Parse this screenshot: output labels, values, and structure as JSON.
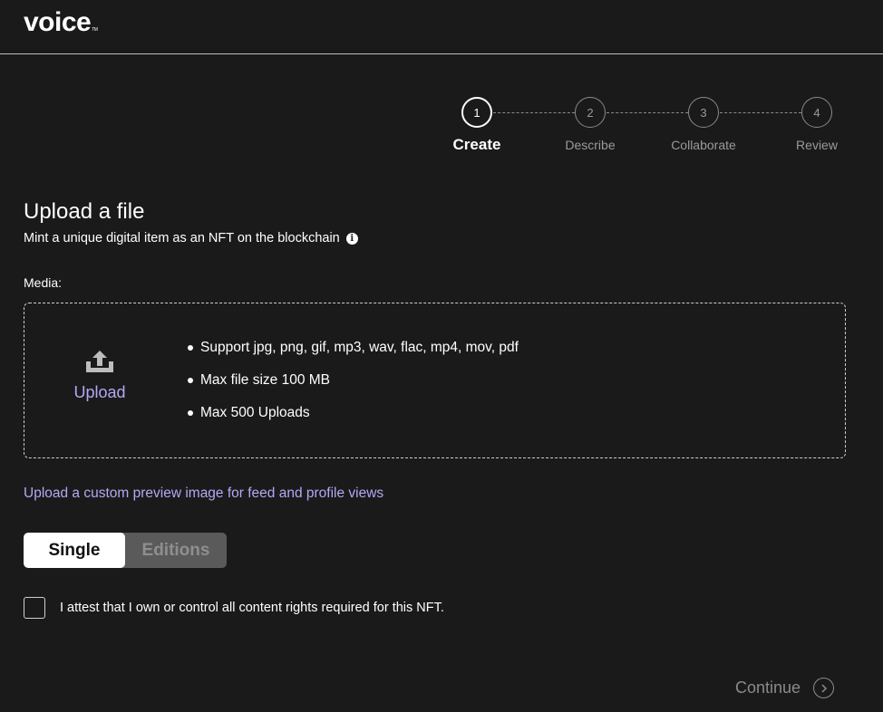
{
  "app": {
    "logo": "voice",
    "logo_tm": "TM"
  },
  "stepper": {
    "steps": [
      {
        "number": "1",
        "label": "Create",
        "active": true
      },
      {
        "number": "2",
        "label": "Describe",
        "active": false
      },
      {
        "number": "3",
        "label": "Collaborate",
        "active": false
      },
      {
        "number": "4",
        "label": "Review",
        "active": false
      }
    ]
  },
  "main": {
    "title": "Upload a file",
    "subtitle": "Mint a unique digital item as an NFT on the blockchain",
    "info_icon": "info-icon",
    "media_label": "Media:",
    "upload": {
      "label": "Upload",
      "icon": "upload-icon",
      "requirements": [
        "Support jpg, png, gif, mp3, wav, flac, mp4, mov, pdf",
        "Max file size 100 MB",
        "Max 500 Uploads"
      ]
    },
    "custom_preview_link": "Upload a custom preview image for feed and profile views",
    "edition_toggle": {
      "options": [
        "Single",
        "Editions"
      ],
      "selected": "Single"
    },
    "attest": {
      "checked": false,
      "text": "I attest that I own or control all content rights required for this NFT."
    },
    "continue_label": "Continue"
  },
  "colors": {
    "background": "#1a1a1a",
    "accent_link": "#b3a9f5",
    "muted": "#8a8a8a"
  }
}
